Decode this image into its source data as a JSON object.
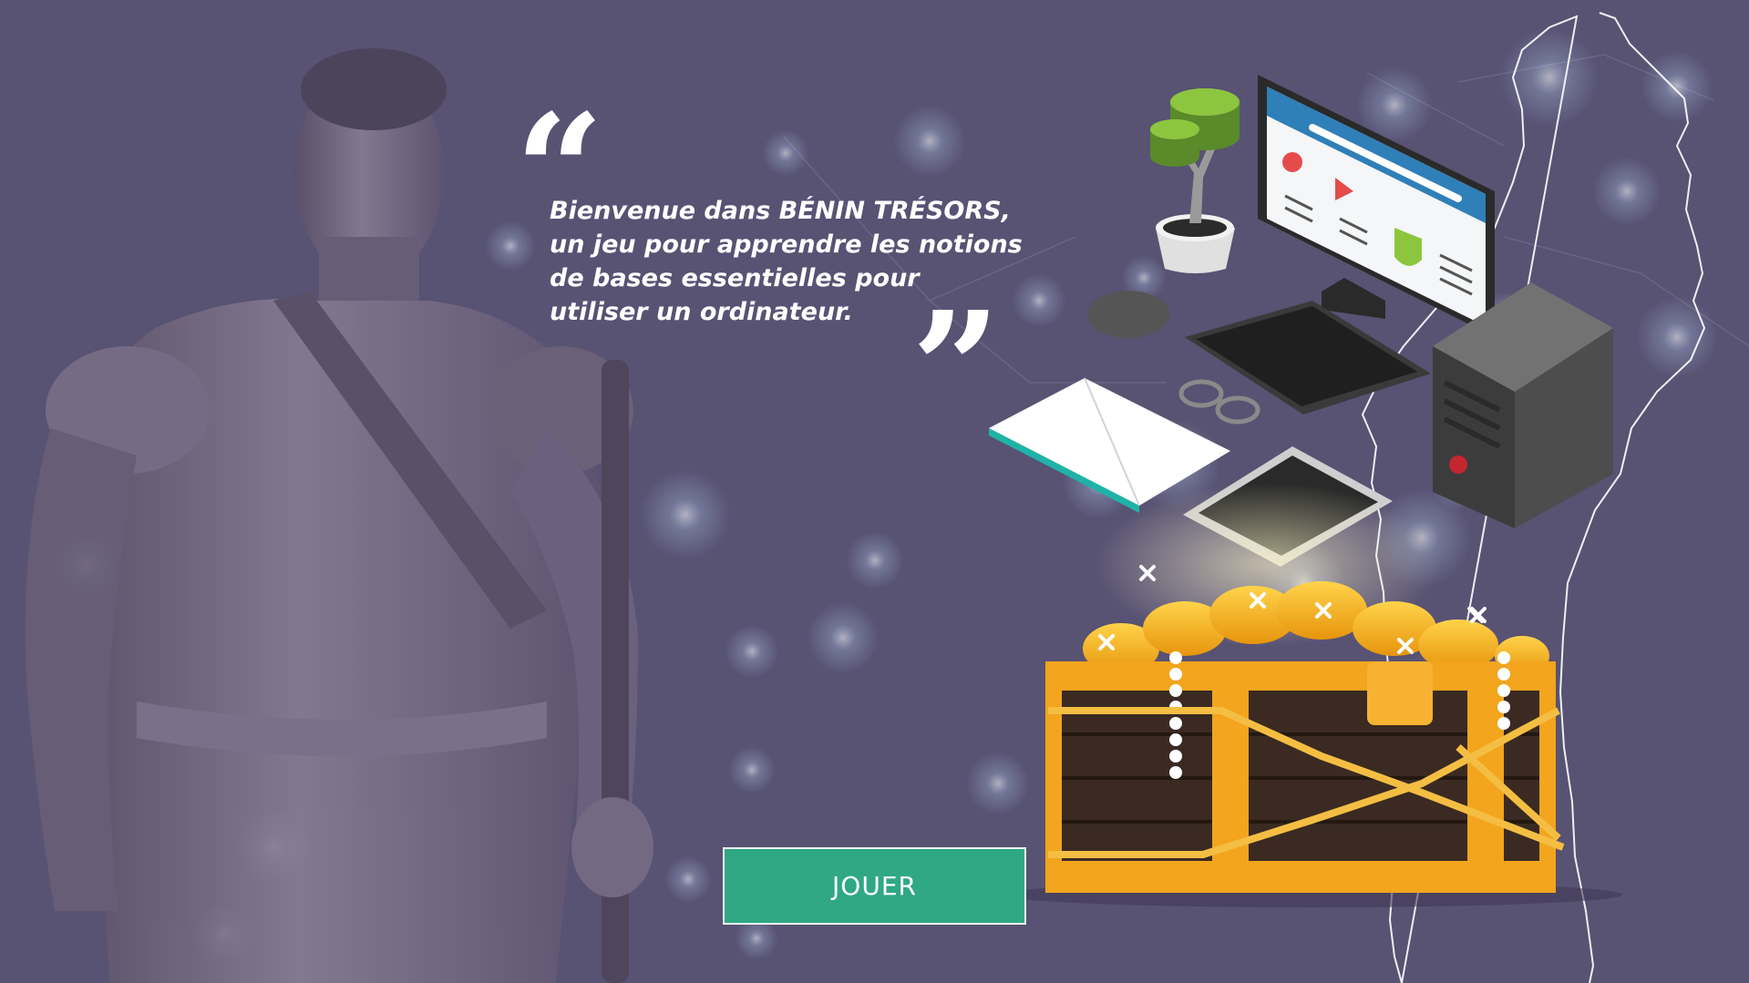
{
  "welcome": {
    "open_quote": "“",
    "text": "Bienvenue dans BÉNIN TRÉSORS, un jeu pour apprendre les notions de bases essentielles pour utiliser un ordinateur.",
    "close_quote": "”"
  },
  "play_button": {
    "label": "JOUER"
  },
  "colors": {
    "background": "#585273",
    "button": "#2fa883",
    "gold": "#f2a51d",
    "chest_wood": "#3a2a22"
  },
  "illustrations": {
    "statue": "amazon-warrior-statue",
    "map": "benin-map-outline",
    "computer": "desktop-computer",
    "chest": "treasure-chest"
  }
}
